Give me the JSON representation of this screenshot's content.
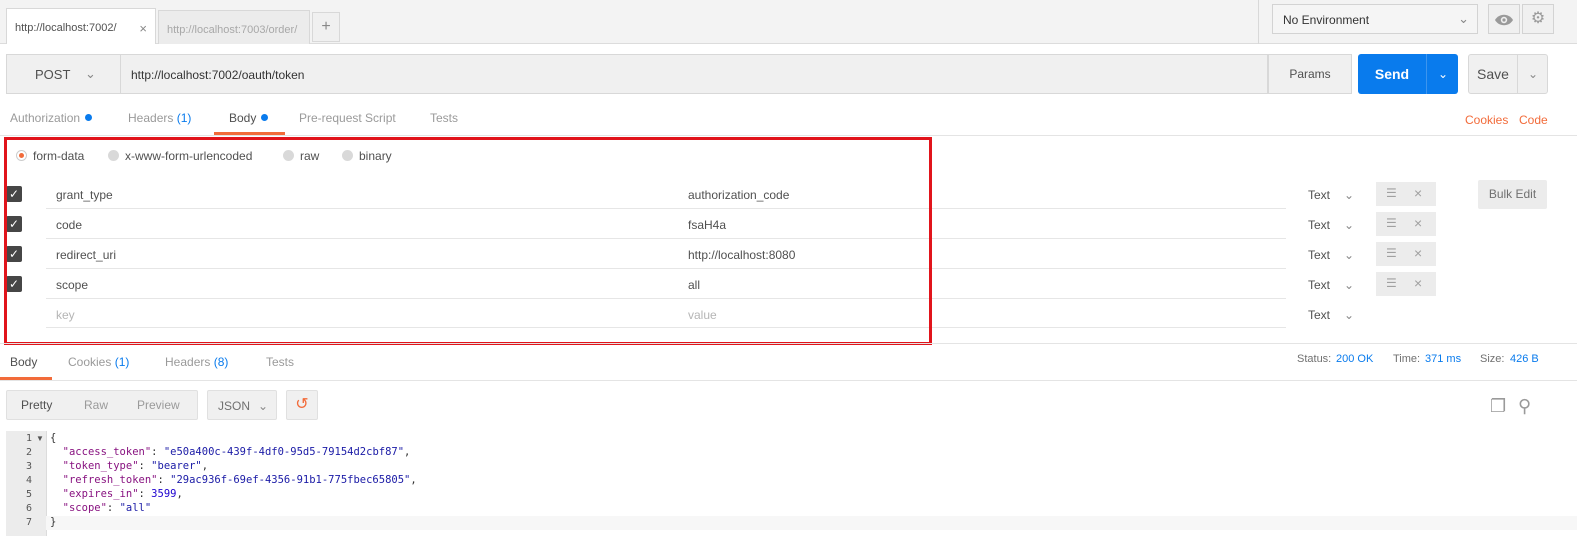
{
  "tabs": [
    {
      "label": "http://localhost:7002/",
      "close": "×"
    },
    {
      "label": "http://localhost:7003/order/"
    }
  ],
  "tab_add": "+",
  "environment": {
    "selected": "No Environment"
  },
  "request": {
    "method": "POST",
    "url": "http://localhost:7002/oauth/token",
    "params_label": "Params",
    "send_label": "Send",
    "save_label": "Save"
  },
  "request_tabs": [
    {
      "label": "Authorization"
    },
    {
      "label": "Headers",
      "count": "(1)"
    },
    {
      "label": "Body"
    },
    {
      "label": "Pre-request Script"
    },
    {
      "label": "Tests"
    }
  ],
  "links": {
    "cookies": "Cookies",
    "code": "Code"
  },
  "body_modes": [
    {
      "label": "form-data",
      "selected": true
    },
    {
      "label": "x-www-form-urlencoded"
    },
    {
      "label": "raw"
    },
    {
      "label": "binary"
    }
  ],
  "form_rows": [
    {
      "key": "grant_type",
      "value": "authorization_code",
      "type": "Text"
    },
    {
      "key": "code",
      "value": "fsaH4a",
      "type": "Text"
    },
    {
      "key": "redirect_uri",
      "value": "http://localhost:8080",
      "type": "Text"
    },
    {
      "key": "scope",
      "value": "all",
      "type": "Text"
    }
  ],
  "new_row": {
    "key_placeholder": "key",
    "value_placeholder": "value",
    "type": "Text"
  },
  "bulk_edit_label": "Bulk Edit",
  "response_tabs": [
    {
      "label": "Body"
    },
    {
      "label": "Cookies",
      "count": "(1)"
    },
    {
      "label": "Headers",
      "count": "(8)"
    },
    {
      "label": "Tests"
    }
  ],
  "status": {
    "status_label": "Status:",
    "status_value": "200 OK",
    "time_label": "Time:",
    "time_value": "371 ms",
    "size_label": "Size:",
    "size_value": "426 B"
  },
  "view_modes": [
    "Pretty",
    "Raw",
    "Preview"
  ],
  "format": "JSON",
  "code": {
    "line_numbers": [
      "1",
      "2",
      "3",
      "4",
      "5",
      "6",
      "7"
    ],
    "open": "{",
    "close": "}",
    "entries": [
      {
        "key": "\"access_token\"",
        "value": "\"e50a400c-439f-4df0-95d5-79154d2cbf87\"",
        "trail": ","
      },
      {
        "key": "\"token_type\"",
        "value": "\"bearer\"",
        "trail": ","
      },
      {
        "key": "\"refresh_token\"",
        "value": "\"29ac936f-69ef-4356-91b1-775fbec65805\"",
        "trail": ","
      },
      {
        "key": "\"expires_in\"",
        "value": "3599",
        "trail": ","
      },
      {
        "key": "\"scope\"",
        "value": "\"all\"",
        "trail": ""
      }
    ]
  },
  "colors": {
    "accent": "#f26b3a",
    "send": "#097bed",
    "highlight": "#e1141b"
  }
}
